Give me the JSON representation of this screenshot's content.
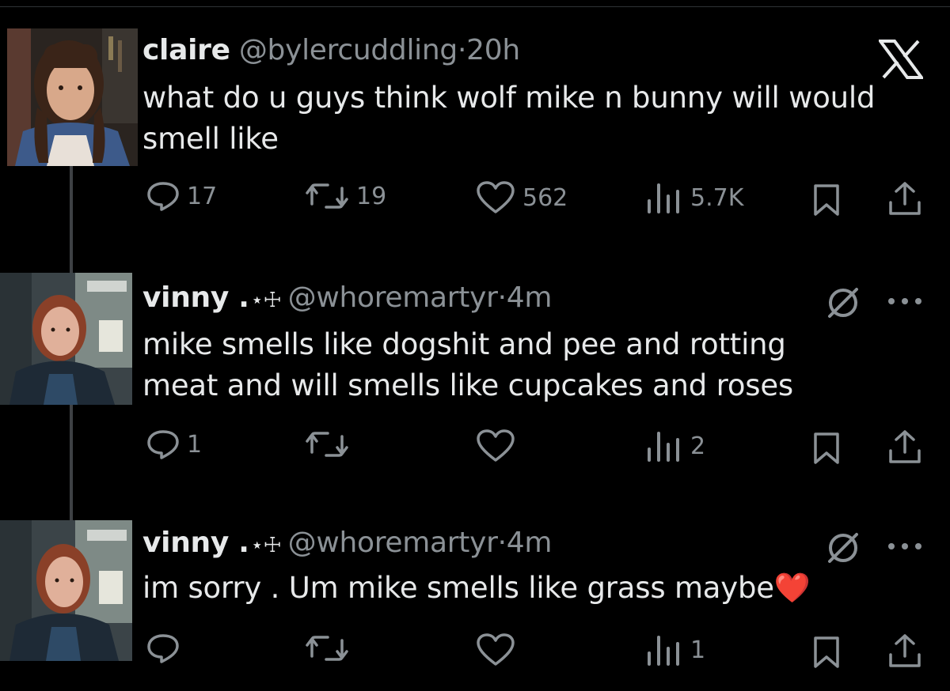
{
  "tweets": [
    {
      "name": "claire",
      "handle": "@bylercuddling",
      "dot": "·",
      "time": "20h",
      "text": "what do u guys think wolf mike n bunny will would smell like",
      "replies": "17",
      "retweets": "19",
      "likes": "562",
      "views": "5.7K",
      "corner_icon": "x-logo-icon"
    },
    {
      "name": "vinny .",
      "decoration": "⋆☩",
      "handle": "@whoremartyr",
      "dot": "·",
      "time": "4m",
      "text": "mike smells like dogshit and pee and rotting meat and will smells like cupcakes and roses",
      "replies": "1",
      "retweets": "",
      "likes": "",
      "views": "2",
      "corner_icon": "grok-icon"
    },
    {
      "name": "vinny .",
      "decoration": "⋆☩",
      "handle": "@whoremartyr",
      "dot": "·",
      "time": "4m",
      "text": "im sorry . Um mike smells like grass maybe",
      "emoji": "❤️",
      "replies": "",
      "retweets": "",
      "likes": "",
      "views": "1",
      "corner_icon": "grok-icon"
    }
  ],
  "colors": {
    "background": "#000000",
    "text": "#e7e9ea",
    "muted": "#8b9196",
    "thread_line": "#3e4144"
  },
  "icons": [
    "reply-icon",
    "retweet-icon",
    "like-icon",
    "views-icon",
    "bookmark-icon",
    "share-icon",
    "more-icon"
  ]
}
